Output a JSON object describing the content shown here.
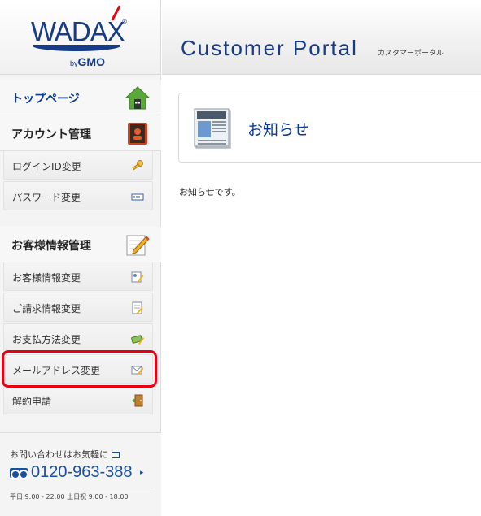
{
  "logo": {
    "brand": "WADAX",
    "reg": "®",
    "by": "by",
    "gmo": "GMO"
  },
  "header": {
    "title": "Customer Portal",
    "subtitle": "カスタマーポータル"
  },
  "nav": {
    "top_page": "トップページ",
    "account_section": "アカウント管理",
    "account_items": [
      {
        "label": "ログインID変更",
        "icon": "key-icon"
      },
      {
        "label": "パスワード変更",
        "icon": "password-field-icon"
      }
    ],
    "customer_section": "お客様情報管理",
    "customer_items": [
      {
        "label": "お客様情報変更",
        "icon": "edit-profile-icon"
      },
      {
        "label": "ご請求情報変更",
        "icon": "billing-edit-icon"
      },
      {
        "label": "お支払方法変更",
        "icon": "payment-icon"
      },
      {
        "label": "メールアドレス変更",
        "icon": "mail-edit-icon"
      },
      {
        "label": "解約申請",
        "icon": "exit-door-icon"
      }
    ]
  },
  "contact": {
    "question": "お問い合わせはお気軽に",
    "phone": "0120-963-388",
    "hours": "平日 9:00 - 22:00  土日祝 9:00 - 18:00"
  },
  "main": {
    "panel_title": "お知らせ",
    "body": "お知らせです。"
  },
  "colors": {
    "brand_blue": "#173b86",
    "link_blue": "#0a3a91",
    "highlight_red": "#e60012"
  }
}
